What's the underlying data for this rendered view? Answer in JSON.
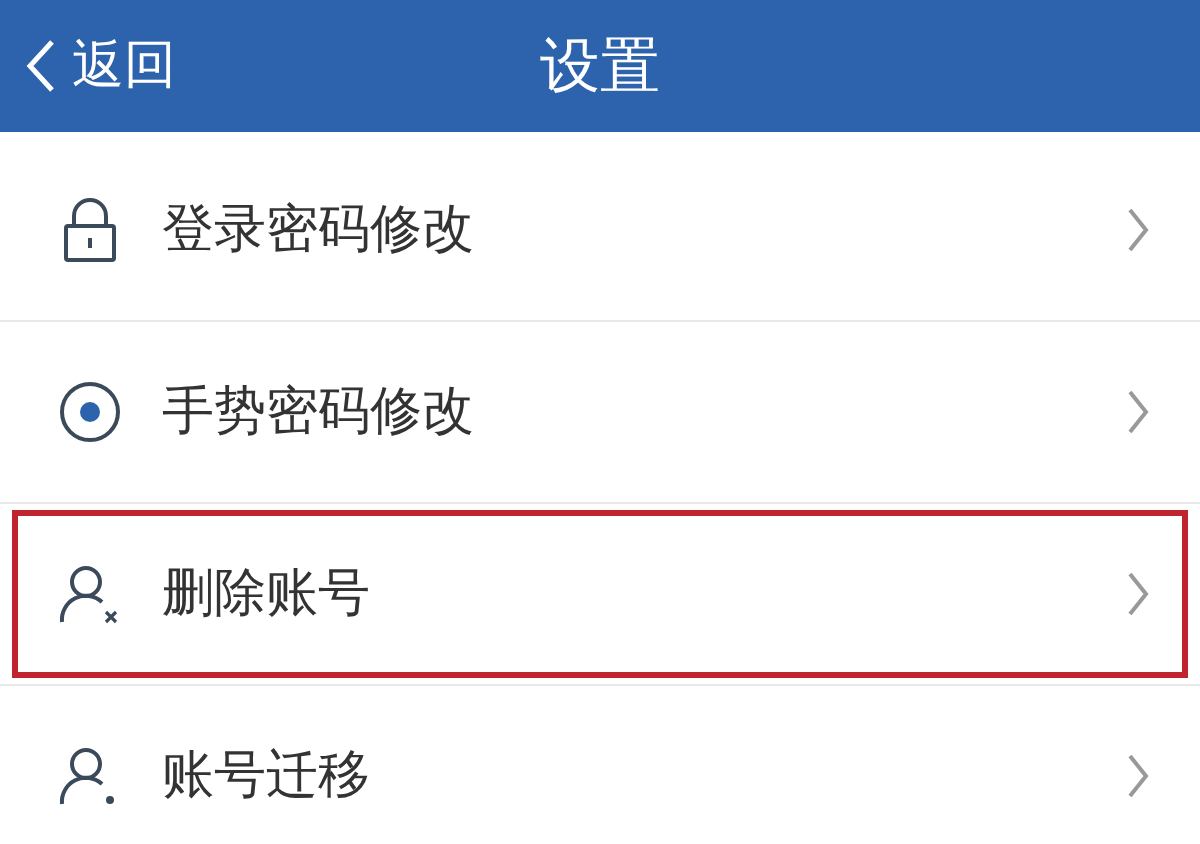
{
  "header": {
    "back": "返回",
    "title": "设置"
  },
  "items": [
    {
      "label": "登录密码修改",
      "highlighted": false
    },
    {
      "label": "手势密码修改",
      "highlighted": false
    },
    {
      "label": "删除账号",
      "highlighted": true
    },
    {
      "label": "账号迁移",
      "highlighted": false
    }
  ]
}
